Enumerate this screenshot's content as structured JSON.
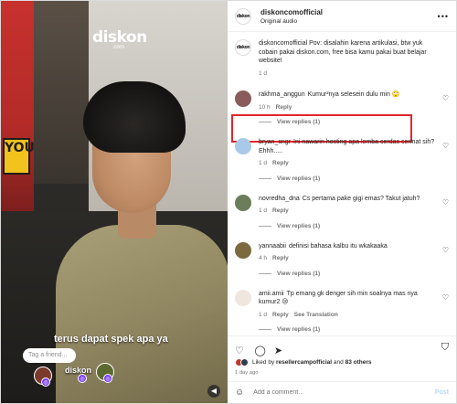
{
  "media": {
    "brand_logo": "diskon",
    "brand_sub": ".com",
    "poster_text": "YOU",
    "caption": "terus dapat spek apa ya",
    "tag_prompt": "Tag a friend...",
    "tag_label": "diskon",
    "mute_icon": "speaker-muted-icon"
  },
  "header": {
    "avatar_text": "diskon",
    "username": "diskoncomofficial",
    "audio": "Original audio",
    "more_icon": "•••"
  },
  "caption_comment": {
    "avatar_text": "diskon",
    "text": "diskoncomofficial Pov: disalahin karena artikulasi, btw yuk cobain pakai diskon.com, free bisa kamu pakai buat belajar website!",
    "time": "1 d"
  },
  "comments": [
    {
      "user": "rakhma_anggun",
      "text": "Kumur²nya selesein dulu min 🙄",
      "time": "10 h",
      "reply": "Reply",
      "avatar_color": "#8a5b5b"
    },
    {
      "user": "bryan_sngr",
      "text": "Ini nawarin hosting apa lomba cerdas cermat sih? Ehhh.....",
      "time": "1 d",
      "reply": "Reply",
      "avatar_color": "#a9c9e9"
    },
    {
      "user": "novredha_dna",
      "text": "Cs pertama pake gigi emas? Takut jatuh?",
      "time": "1 d",
      "reply": "Reply",
      "avatar_color": "#6b7d5a"
    },
    {
      "user": "yannaabii",
      "text": "definisi bahasa kalbu itu wkakaaka",
      "time": "4 h",
      "reply": "Reply",
      "avatar_color": "#7a6a3e"
    },
    {
      "user": "amii.amii",
      "text": "Tp emang gk denger sih min soalnya mas nya kumur2 😢",
      "time": "1 d",
      "reply": "Reply",
      "see_translation": "See Translation",
      "avatar_color": "#f0e6e0"
    }
  ],
  "view_replies": "View replies (1)",
  "actions": {
    "like_icon": "heart-icon",
    "comment_icon": "comment-icon",
    "share_icon": "share-icon",
    "save_icon": "bookmark-icon"
  },
  "likes": {
    "prefix": "Liked by",
    "user": "resellercampofficial",
    "and": "and",
    "others": "83 others"
  },
  "time_ago": "1 day ago",
  "add_comment": {
    "placeholder": "Add a comment...",
    "post": "Post"
  }
}
